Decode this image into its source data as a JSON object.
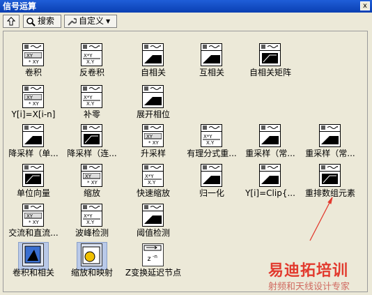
{
  "window": {
    "title": "信号运算",
    "close_label": "x"
  },
  "toolbar": {
    "up_label": "",
    "search_label": "搜索",
    "customize_label": "自定义"
  },
  "items": [
    {
      "label": "卷积",
      "icon": "convolution-icon"
    },
    {
      "label": "反卷积",
      "icon": "deconvolution-icon"
    },
    {
      "label": "自相关",
      "icon": "autocorrelation-icon"
    },
    {
      "label": "互相关",
      "icon": "crosscorrelation-icon"
    },
    {
      "label": "自相关矩阵",
      "icon": "autocorrelation-matrix-icon"
    },
    {
      "label": "Y[i]=X[i-n]",
      "icon": "shift-icon"
    },
    {
      "label": "补零",
      "icon": "zero-pad-icon"
    },
    {
      "label": "展开相位",
      "icon": "unwrap-phase-icon"
    },
    {
      "label": "降采样（单...",
      "icon": "downsample-single-icon"
    },
    {
      "label": "降采样（连...",
      "icon": "downsample-continuous-icon"
    },
    {
      "label": "升采样",
      "icon": "upsample-icon"
    },
    {
      "label": "有理分式重...",
      "icon": "rational-resample-icon"
    },
    {
      "label": "重采样（常...",
      "icon": "resample-const-icon"
    },
    {
      "label": "重采样（常...",
      "icon": "resample-const2-icon"
    },
    {
      "label": "单位向量",
      "icon": "unit-vector-icon"
    },
    {
      "label": "缩放",
      "icon": "scale-icon"
    },
    {
      "label": "快速缩放",
      "icon": "quick-scale-icon"
    },
    {
      "label": "归一化",
      "icon": "normalize-icon"
    },
    {
      "label": "Y[i]=Clip{...",
      "icon": "clip-icon"
    },
    {
      "label": "重排数组元素",
      "icon": "reorder-array-icon"
    },
    {
      "label": "交流和直流...",
      "icon": "ac-dc-icon"
    },
    {
      "label": "波峰检测",
      "icon": "peak-detect-icon"
    },
    {
      "label": "阈值检测",
      "icon": "threshold-detect-icon"
    }
  ],
  "categories": [
    {
      "label": "卷积和相关",
      "icon": "convolution-category-icon"
    },
    {
      "label": "缩放和映射",
      "icon": "scale-mapping-category-icon"
    },
    {
      "label": "Z变换延迟节点",
      "icon": "z-delay-icon"
    }
  ],
  "watermark": {
    "line1": "易迪拓培训",
    "line2": "射频和天线设计专家"
  },
  "colors": {
    "titlebar": "#0a3fb2",
    "background": "#ece9d8",
    "arrow": "#e23a2e"
  }
}
